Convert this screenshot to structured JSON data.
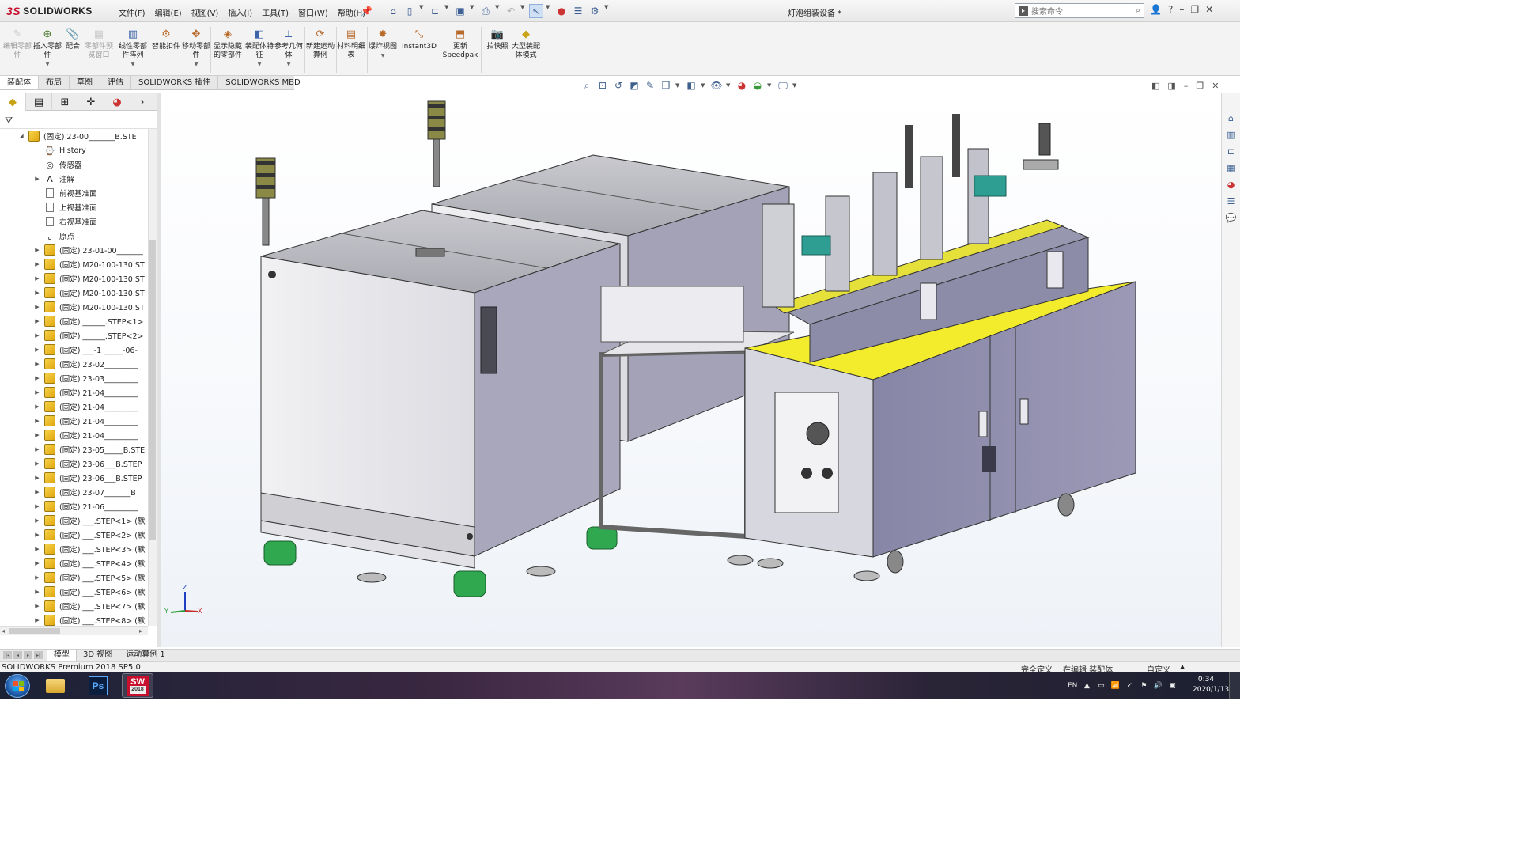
{
  "app": {
    "logo_ds": "3S",
    "logo_text": "SOLIDWORKS",
    "doc_title": "灯泡组装设备 *"
  },
  "menus": [
    "文件(F)",
    "编辑(E)",
    "视图(V)",
    "插入(I)",
    "工具(T)",
    "窗口(W)",
    "帮助(H)"
  ],
  "search": {
    "placeholder": "搜索命令"
  },
  "ribbon": [
    {
      "label": "编辑零部件",
      "disabled": true,
      "icon": "edit-component-icon"
    },
    {
      "label": "插入零部件",
      "disabled": false,
      "icon": "insert-component-icon"
    },
    {
      "label": "配合",
      "disabled": false,
      "icon": "mate-icon"
    },
    {
      "label": "零部件预览窗口",
      "disabled": true,
      "icon": "component-preview-icon"
    },
    {
      "label": "线性零部件阵列",
      "disabled": false,
      "icon": "linear-pattern-icon"
    },
    {
      "label": "智能扣件",
      "disabled": false,
      "icon": "smart-fasteners-icon"
    },
    {
      "label": "移动零部件",
      "disabled": false,
      "icon": "move-component-icon"
    },
    {
      "label": "显示隐藏的零部件",
      "disabled": false,
      "icon": "show-hidden-icon"
    },
    {
      "label": "装配体特征",
      "disabled": false,
      "icon": "assembly-features-icon"
    },
    {
      "label": "参考几何体",
      "disabled": false,
      "icon": "reference-geometry-icon"
    },
    {
      "label": "新建运动算例",
      "disabled": false,
      "icon": "new-motion-study-icon"
    },
    {
      "label": "材料明细表",
      "disabled": false,
      "icon": "bill-of-materials-icon"
    },
    {
      "label": "爆炸视图",
      "disabled": false,
      "icon": "exploded-view-icon"
    },
    {
      "label": "Instant3D",
      "disabled": false,
      "icon": "instant3d-icon"
    },
    {
      "label": "更新Speedpak",
      "disabled": false,
      "icon": "update-speedpak-icon"
    },
    {
      "label": "拍快照",
      "disabled": false,
      "icon": "snapshot-icon"
    },
    {
      "label": "大型装配体模式",
      "disabled": false,
      "icon": "large-assembly-icon"
    }
  ],
  "cmd_tabs": [
    "装配体",
    "布局",
    "草图",
    "评估",
    "SOLIDWORKS 插件",
    "SOLIDWORKS MBD"
  ],
  "tree": {
    "root": "(固定) 23-00_______B.STE",
    "items": [
      {
        "label": "History",
        "type": "history",
        "expander": false
      },
      {
        "label": "传感器",
        "type": "sensor",
        "expander": false
      },
      {
        "label": "注解",
        "type": "annotation",
        "expander": true
      },
      {
        "label": "前视基准面",
        "type": "plane",
        "expander": false
      },
      {
        "label": "上视基准面",
        "type": "plane",
        "expander": false
      },
      {
        "label": "右视基准面",
        "type": "plane",
        "expander": false
      },
      {
        "label": "原点",
        "type": "origin",
        "expander": false
      },
      {
        "label": "(固定) 23-01-00_______",
        "type": "part",
        "expander": true
      },
      {
        "label": "(固定) M20-100-130.ST",
        "type": "part",
        "expander": true
      },
      {
        "label": "(固定) M20-100-130.ST",
        "type": "part",
        "expander": true
      },
      {
        "label": "(固定) M20-100-130.ST",
        "type": "part",
        "expander": true
      },
      {
        "label": "(固定) M20-100-130.ST",
        "type": "part",
        "expander": true
      },
      {
        "label": "(固定) ______.STEP<1>",
        "type": "part",
        "expander": true
      },
      {
        "label": "(固定) ______.STEP<2>",
        "type": "part",
        "expander": true
      },
      {
        "label": "(固定) ___-1 _____-06-",
        "type": "part",
        "expander": true
      },
      {
        "label": "(固定) 23-02_________",
        "type": "part",
        "expander": true
      },
      {
        "label": "(固定) 23-03_________",
        "type": "part",
        "expander": true
      },
      {
        "label": "(固定) 21-04_________",
        "type": "part",
        "expander": true
      },
      {
        "label": "(固定) 21-04_________",
        "type": "part",
        "expander": true
      },
      {
        "label": "(固定) 21-04_________",
        "type": "part",
        "expander": true
      },
      {
        "label": "(固定) 21-04_________",
        "type": "part",
        "expander": true
      },
      {
        "label": "(固定) 23-05_____B.STE",
        "type": "part",
        "expander": true
      },
      {
        "label": "(固定) 23-06___B.STEP",
        "type": "part",
        "expander": true
      },
      {
        "label": "(固定) 23-06___B.STEP",
        "type": "part",
        "expander": true
      },
      {
        "label": "(固定) 23-07_______B",
        "type": "part",
        "expander": true
      },
      {
        "label": "(固定) 21-06_________",
        "type": "part",
        "expander": true
      },
      {
        "label": "(固定) ___.STEP<1> (默",
        "type": "part",
        "expander": true
      },
      {
        "label": "(固定) ___.STEP<2> (默",
        "type": "part",
        "expander": true
      },
      {
        "label": "(固定) ___.STEP<3> (默",
        "type": "part",
        "expander": true
      },
      {
        "label": "(固定) ___.STEP<4> (默",
        "type": "part",
        "expander": true
      },
      {
        "label": "(固定) ___.STEP<5> (默",
        "type": "part",
        "expander": true
      },
      {
        "label": "(固定) ___.STEP<6> (默",
        "type": "part",
        "expander": true
      },
      {
        "label": "(固定) ___.STEP<7> (默",
        "type": "part",
        "expander": true
      },
      {
        "label": "(固定) ___.STEP<8> (默",
        "type": "part",
        "expander": true
      }
    ]
  },
  "bottom_tabs": [
    "模型",
    "3D 视图",
    "运动算例 1"
  ],
  "status": {
    "left": "SOLIDWORKS Premium 2018 SP5.0",
    "defined": "完全定义",
    "editing": "在编辑 装配体",
    "custom": "自定义"
  },
  "taskbar": {
    "apps": [
      "file-explorer",
      "photoshop",
      "solidworks-2018"
    ],
    "ps_label": "Ps",
    "sw_label": "SW",
    "sw_version": "2018",
    "lang": "EN",
    "time": "0:34",
    "date": "2020/1/13"
  },
  "triad": {
    "x": "X",
    "y": "Y",
    "z": "Z"
  },
  "colors": {
    "accent": "#c8102e",
    "cabinet": "#8b8aa6",
    "top_plate": "#f2ec2c",
    "wheel": "#2fa84f"
  }
}
